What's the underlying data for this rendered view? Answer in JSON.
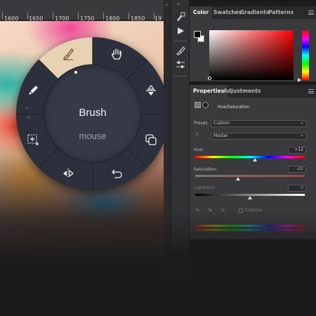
{
  "ruler": {
    "labels": [
      "1600",
      "1650",
      "1700",
      "1750",
      "1800",
      "1850",
      "19"
    ]
  },
  "dial": {
    "title": "Brush",
    "subtitle": "mouse",
    "icons": [
      "brush-icon",
      "hand-icon",
      "flip-vertical-icon",
      "copy-icon",
      "undo-icon",
      "flip-horizontal-icon",
      "add-selection-icon",
      "pencil-icon"
    ],
    "active_color": "#e8d2b4"
  },
  "color_panel": {
    "tabs": [
      "Color",
      "Swatches",
      "Gradients",
      "Patterns"
    ],
    "active_tab": "Color"
  },
  "properties_panel": {
    "tabs": [
      "Properties",
      "Adjustments"
    ],
    "active_tab": "Properties",
    "adjustment_name": "Hue/Saturation",
    "preset_label": "Preset:",
    "preset_value": "Custom",
    "channel_value": "Master",
    "hue_label": "Hue:",
    "hue_value": "+12",
    "hue_fraction": 0.53,
    "saturation_label": "Saturation:",
    "saturation_value": "-22",
    "saturation_fraction": 0.39,
    "lightness_label": "Lightness:",
    "lightness_value": "0",
    "lightness_fraction": 0.5,
    "colorize_label": "Colorize"
  },
  "colors": {
    "panel_bg": "#3a3a3c",
    "dial_bg": "#2c2f3c",
    "accent": "#e8d2b4"
  }
}
